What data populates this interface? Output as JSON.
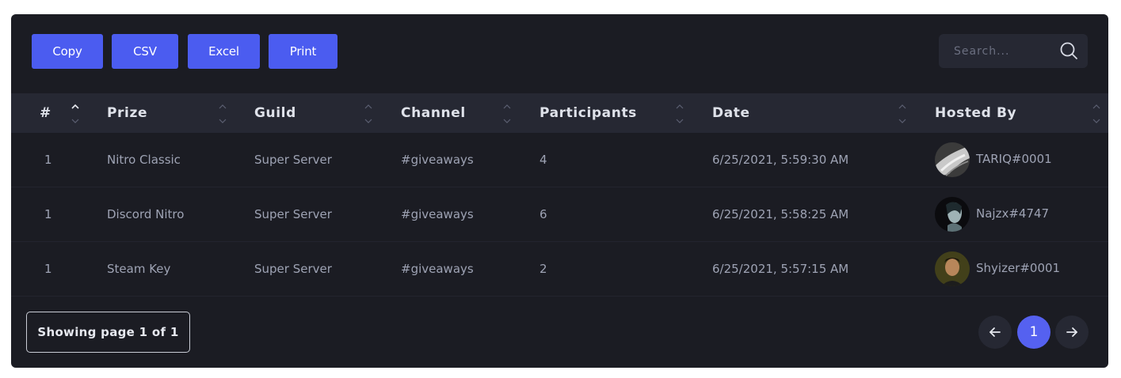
{
  "toolbar": {
    "buttons": [
      "Copy",
      "CSV",
      "Excel",
      "Print"
    ],
    "search_placeholder": "Search..."
  },
  "table": {
    "columns": [
      "#",
      "Prize",
      "Guild",
      "Channel",
      "Participants",
      "Date",
      "Hosted By"
    ],
    "rows": [
      {
        "num": "1",
        "prize": "Nitro Classic",
        "guild": "Super Server",
        "channel": "#giveaways",
        "participants": "4",
        "date": "6/25/2021, 5:59:30 AM",
        "host": "TARIQ#0001"
      },
      {
        "num": "1",
        "prize": "Discord Nitro",
        "guild": "Super Server",
        "channel": "#giveaways",
        "participants": "6",
        "date": "6/25/2021, 5:58:25 AM",
        "host": "Najzx#4747"
      },
      {
        "num": "1",
        "prize": "Steam Key",
        "guild": "Super Server",
        "channel": "#giveaways",
        "participants": "2",
        "date": "6/25/2021, 5:57:15 AM",
        "host": "Shyizer#0001"
      }
    ]
  },
  "footer": {
    "page_info": "Showing page 1 of 1",
    "current_page": "1"
  },
  "colors": {
    "card_bg": "#1b1c23",
    "header_bg": "#262833",
    "button_accent": "#4b5cf0",
    "page_accent": "#5561f0"
  }
}
